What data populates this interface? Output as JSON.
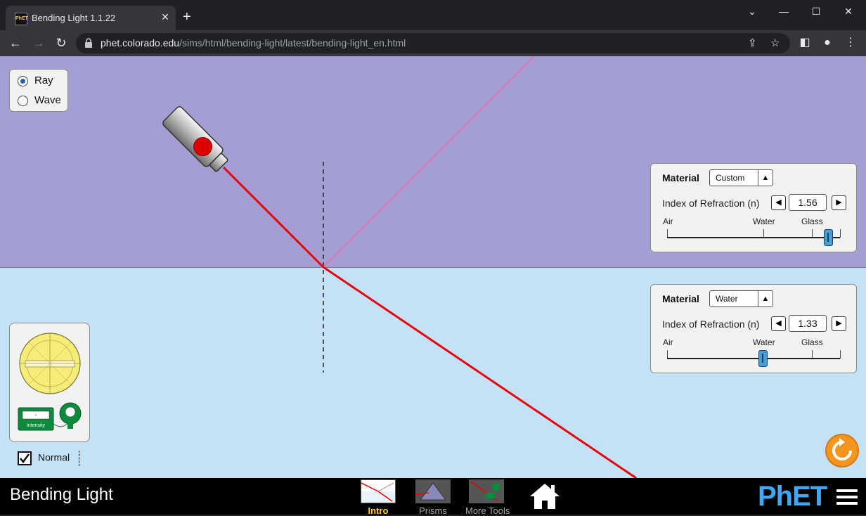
{
  "browser": {
    "tab_title": "Bending Light 1.1.22",
    "tab_favicon_text": "PhET",
    "url_host": "phet.colorado.edu",
    "url_path": "/sims/html/bending-light/latest/bending-light_en.html",
    "window_controls": {
      "minimize": "—",
      "maximize": "☐",
      "close": "✕",
      "tab_list": "⌄"
    }
  },
  "sim": {
    "mode": {
      "options": [
        {
          "label": "Ray",
          "selected": true
        },
        {
          "label": "Wave",
          "selected": false
        }
      ]
    },
    "top_medium": {
      "material_label": "Material",
      "material_value": "Custom",
      "ior_label": "Index of Refraction (n)",
      "ior_value": "1.56",
      "slider_fraction": 0.93,
      "ticks": [
        "Air",
        "Water",
        "Glass"
      ]
    },
    "bottom_medium": {
      "material_label": "Material",
      "material_value": "Water",
      "ior_label": "Index of Refraction (n)",
      "ior_value": "1.33",
      "slider_fraction": 0.55,
      "ticks": [
        "Air",
        "Water",
        "Glass"
      ]
    },
    "toolbox": {
      "intensity_label": "Intensity",
      "intensity_reading": "-"
    },
    "normal": {
      "label": "Normal",
      "checked": true
    },
    "colors": {
      "top": "#a49fd2",
      "bottom": "#c5e1f5",
      "ray": "#e8000b",
      "reflected": "#c784b8"
    }
  },
  "navbar": {
    "title": "Bending Light",
    "screens": [
      {
        "label": "Intro",
        "active": true
      },
      {
        "label": "Prisms",
        "active": false
      },
      {
        "label": "More Tools",
        "active": false
      }
    ],
    "brand": "PhET"
  }
}
